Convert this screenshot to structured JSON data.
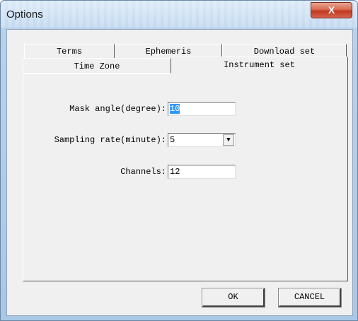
{
  "window": {
    "title": "Options",
    "close_label": "X"
  },
  "tabs": {
    "terms": "Terms",
    "ephemeris": "Ephemeris",
    "download_set": "Download set",
    "time_zone": "Time Zone",
    "instrument_set": "Instrument set"
  },
  "form": {
    "mask_angle_label": "Mask angle(degree):",
    "mask_angle_value": "10",
    "sampling_rate_label": "Sampling rate(minute):",
    "sampling_rate_value": "5",
    "dropdown_arrow": "▼",
    "channels_label": "Channels:",
    "channels_value": "12"
  },
  "buttons": {
    "ok": "OK",
    "cancel": "CANCEL"
  },
  "colors": {
    "close": "#c0391f",
    "selection": "#3399ff",
    "frame": "#b8d2ec"
  }
}
